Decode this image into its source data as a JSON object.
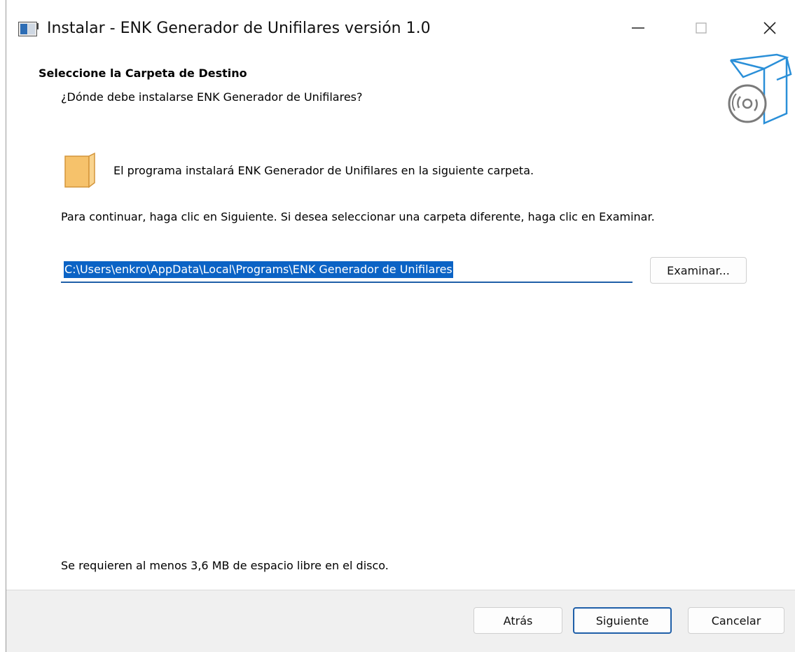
{
  "window": {
    "title": "Instalar - ENK Generador de Unifilares versión 1.0",
    "controls": {
      "minimize": "—",
      "maximize": "☐",
      "close": "✕"
    }
  },
  "header": {
    "title": "Seleccione la Carpeta de Destino",
    "subtitle": "¿Dónde debe instalarse ENK Generador de Unifilares?",
    "image_icon": "install-box-cd-icon"
  },
  "body": {
    "folder_icon": "folder-icon",
    "info_text": "El programa instalará ENK Generador de Unifilares en la siguiente carpeta.",
    "continue_text": "Para continuar, haga clic en Siguiente. Si desea seleccionar una carpeta diferente, haga clic en Examinar.",
    "path_value": "C:\\Users\\enkro\\AppData\\Local\\Programs\\ENK Generador de Unifilares",
    "browse_label": "Examinar...",
    "disk_space_text": "Se requieren al menos 3,6 MB de espacio libre en el disco."
  },
  "footer": {
    "back_label": "Atrás",
    "next_label": "Siguiente",
    "cancel_label": "Cancelar"
  },
  "colors": {
    "accent": "#1f5fa8",
    "selection": "#0b63c5",
    "footer_bg": "#f0f0f0",
    "folder": "#f6c26b"
  }
}
